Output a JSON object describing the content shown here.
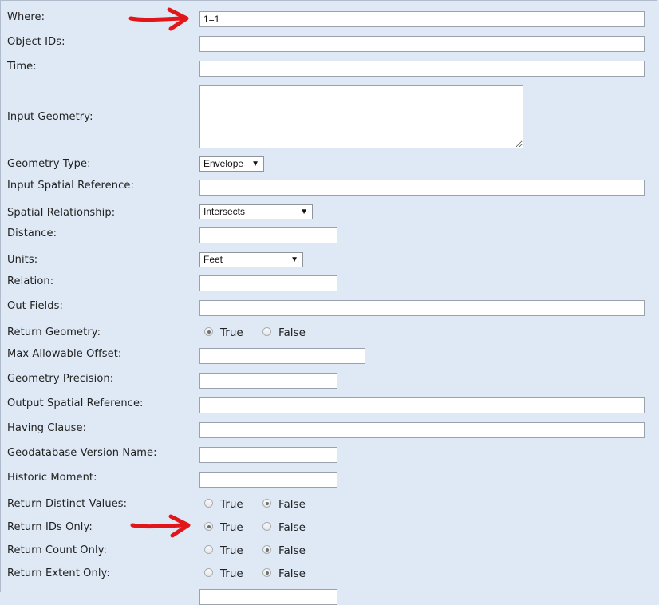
{
  "fields": {
    "where": {
      "label": "Where:",
      "value": "1=1"
    },
    "object_ids": {
      "label": "Object IDs:",
      "value": ""
    },
    "time": {
      "label": "Time:",
      "value": ""
    },
    "input_geometry": {
      "label": "Input Geometry:",
      "value": ""
    },
    "geometry_type": {
      "label": "Geometry Type:",
      "value": "Envelope"
    },
    "input_spatial_reference": {
      "label": "Input Spatial Reference:",
      "value": ""
    },
    "spatial_relationship": {
      "label": "Spatial Relationship:",
      "value": "Intersects"
    },
    "distance": {
      "label": "Distance:",
      "value": ""
    },
    "units": {
      "label": "Units:",
      "value": "Feet"
    },
    "relation": {
      "label": "Relation:",
      "value": ""
    },
    "out_fields": {
      "label": "Out Fields:",
      "value": ""
    },
    "return_geometry": {
      "label": "Return Geometry:",
      "selected": "True"
    },
    "max_allowable_offset": {
      "label": "Max Allowable Offset:",
      "value": ""
    },
    "geometry_precision": {
      "label": "Geometry Precision:",
      "value": ""
    },
    "output_spatial_reference": {
      "label": "Output Spatial Reference:",
      "value": ""
    },
    "having_clause": {
      "label": "Having Clause:",
      "value": ""
    },
    "geodatabase_version_name": {
      "label": "Geodatabase Version Name:",
      "value": ""
    },
    "historic_moment": {
      "label": "Historic Moment:",
      "value": ""
    },
    "return_distinct_values": {
      "label": "Return Distinct Values:",
      "selected": "False"
    },
    "return_ids_only": {
      "label": "Return IDs Only:",
      "selected": "True"
    },
    "return_count_only": {
      "label": "Return Count Only:",
      "selected": "False"
    },
    "return_extent_only": {
      "label": "Return Extent Only:",
      "selected": "False"
    }
  },
  "radio_options": {
    "true_label": "True",
    "false_label": "False"
  },
  "colors": {
    "background": "#dfe9f5",
    "annotation_arrow": "#e0161a"
  }
}
